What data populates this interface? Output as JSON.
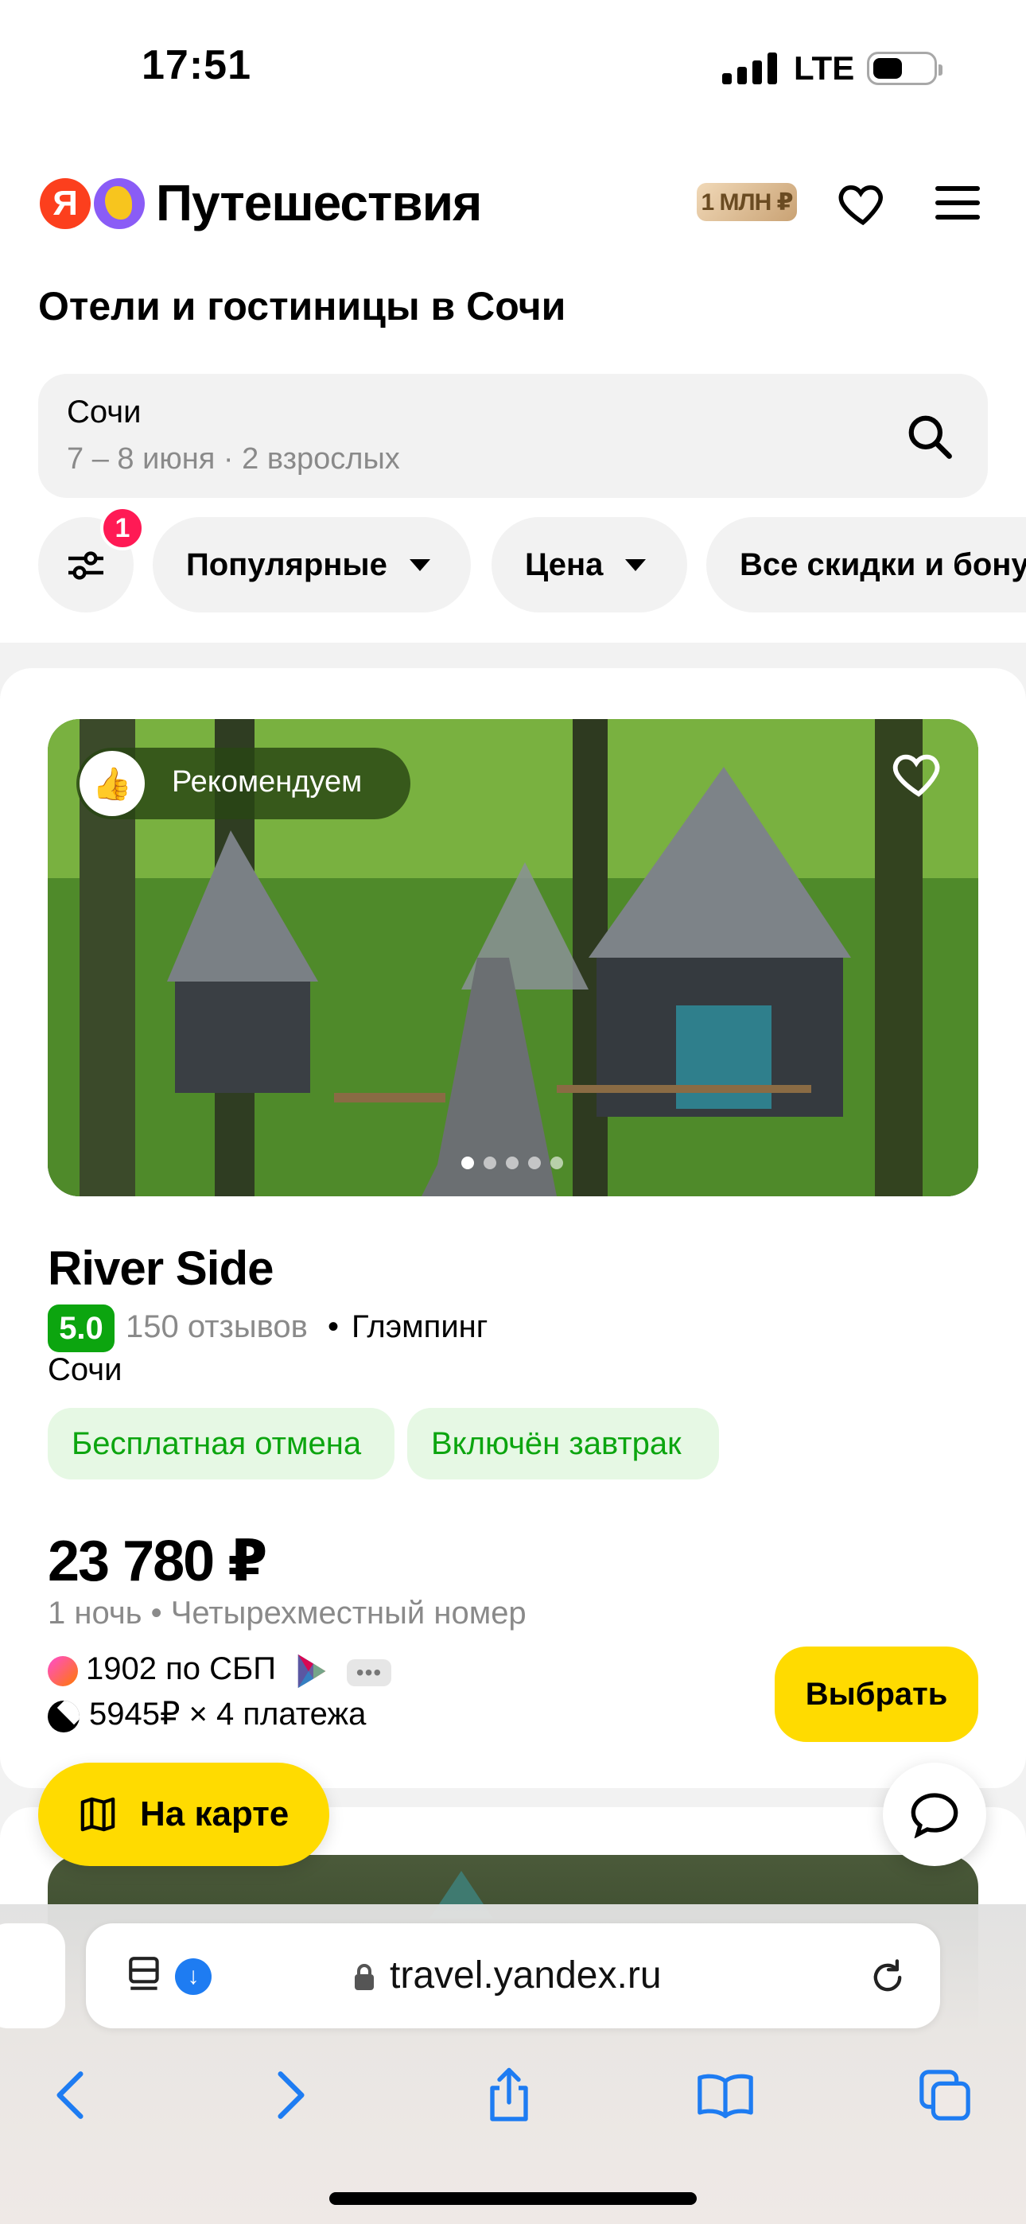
{
  "status_bar": {
    "time": "17:51",
    "network": "LTE"
  },
  "header": {
    "logo_letter": "Я",
    "brand": "Путешествия",
    "badge": "1 МЛН ₽"
  },
  "page_title": "Отели и гостиницы в Сочи",
  "search": {
    "city": "Сочи",
    "meta": "7 – 8 июня · 2 взрослых"
  },
  "filters": {
    "badge_count": "1",
    "chips": [
      "Популярные",
      "Цена",
      "Все скидки и бонусы"
    ]
  },
  "hotel": {
    "badge": "Рекомендуем",
    "name": "River Side",
    "rating": "5.0",
    "reviews": "150 отзывов",
    "separator": "•",
    "kind": "Глэмпинг",
    "city": "Сочи",
    "tags": [
      "Бесплатная отмена",
      "Включён завтрак"
    ],
    "price": "23 780 ₽",
    "price_meta": "1 ночь • Четырехместный номер",
    "sbp": "1902 по СБП",
    "more": "•••",
    "split": "5945₽ × 4 платежа",
    "choose_button": "Выбрать"
  },
  "floating": {
    "map_button": "На карте"
  },
  "browser": {
    "url": "travel.yandex.ru"
  },
  "colors": {
    "accent": "#ffdb00",
    "rating_green": "#0ca50f",
    "badge_red": "#ff1a55",
    "safari_blue": "#1e7cf2"
  }
}
